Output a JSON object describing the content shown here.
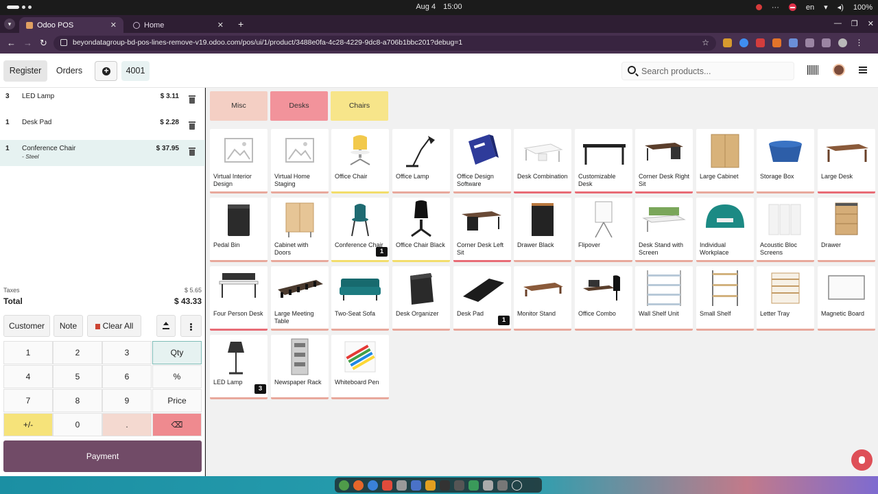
{
  "os": {
    "date": "Aug 4",
    "time": "15:00",
    "lang": "en",
    "battery": "100%"
  },
  "browser": {
    "tabs": [
      {
        "title": "Odoo POS",
        "active": true
      },
      {
        "title": "Home",
        "active": false
      }
    ],
    "url": "beyondatagroup-bd-pos-lines-remove-v19.odoo.com/pos/ui/1/product/3488e0fa-4c28-4229-9dc8-a706b1bbc201?debug=1"
  },
  "nav": {
    "register": "Register",
    "orders": "Orders",
    "order_number": "4001",
    "search_placeholder": "Search products..."
  },
  "order_lines": [
    {
      "qty": "3",
      "name": "LED Lamp",
      "price": "$ 3.11",
      "note": ""
    },
    {
      "qty": "1",
      "name": "Desk Pad",
      "price": "$ 2.28",
      "note": ""
    },
    {
      "qty": "1",
      "name": "Conference Chair",
      "price": "$ 37.95",
      "note": "- Steel",
      "selected": true
    }
  ],
  "totals": {
    "taxes_label": "Taxes",
    "taxes": "$ 5.65",
    "total_label": "Total",
    "total": "$ 43.33"
  },
  "actions": {
    "customer": "Customer",
    "note": "Note",
    "clear_all": "Clear All"
  },
  "numpad": [
    "1",
    "2",
    "3",
    "Qty",
    "4",
    "5",
    "6",
    "%",
    "7",
    "8",
    "9",
    "Price",
    "+/-",
    "0",
    ".",
    "⌫"
  ],
  "payment": "Payment",
  "categories": [
    {
      "name": "Misc",
      "color": "#f4cfc4"
    },
    {
      "name": "Desks",
      "color": "#f2939b"
    },
    {
      "name": "Chairs",
      "color": "#f7e58a"
    }
  ],
  "products": [
    {
      "name": "Virtual Interior Design",
      "strip": "#e8a89c",
      "icon": "image-placeholder"
    },
    {
      "name": "Virtual Home Staging",
      "strip": "#e8a89c",
      "icon": "image-placeholder"
    },
    {
      "name": "Office Chair",
      "strip": "#f2dd6b",
      "icon": "chair-yellow"
    },
    {
      "name": "Office Lamp",
      "strip": "#e8a89c",
      "icon": "desk-lamp"
    },
    {
      "name": "Office Design Software",
      "strip": "#e8a89c",
      "icon": "software-box"
    },
    {
      "name": "Desk Combination",
      "strip": "#e86c76",
      "icon": "desk-white"
    },
    {
      "name": "Customizable Desk",
      "strip": "#e86c76",
      "icon": "desk-black"
    },
    {
      "name": "Corner Desk Right Sit",
      "strip": "#e86c76",
      "icon": "desk-corner"
    },
    {
      "name": "Large Cabinet",
      "strip": "#e8a89c",
      "icon": "cabinet-wood"
    },
    {
      "name": "Storage Box",
      "strip": "#e8a89c",
      "icon": "storage-box"
    },
    {
      "name": "Large Desk",
      "strip": "#e86c76",
      "icon": "desk-wood"
    },
    {
      "name": "Pedal Bin",
      "strip": "#e8a89c",
      "icon": "pedal-bin"
    },
    {
      "name": "Cabinet with Doors",
      "strip": "#e8a89c",
      "icon": "cabinet-doors"
    },
    {
      "name": "Conference Chair",
      "strip": "#f2dd6b",
      "icon": "chair-teal",
      "qty": "1"
    },
    {
      "name": "Office Chair Black",
      "strip": "#f2dd6b",
      "icon": "chair-black"
    },
    {
      "name": "Corner Desk Left Sit",
      "strip": "#e86c76",
      "icon": "desk-corner-left"
    },
    {
      "name": "Drawer Black",
      "strip": "#e8a89c",
      "icon": "drawer-black"
    },
    {
      "name": "Flipover",
      "strip": "#e8a89c",
      "icon": "flipchart"
    },
    {
      "name": "Desk Stand with Screen",
      "strip": "#e8a89c",
      "icon": "desk-screen"
    },
    {
      "name": "Individual Workplace",
      "strip": "#e8a89c",
      "icon": "workplace"
    },
    {
      "name": "Acoustic Bloc Screens",
      "strip": "#e8a89c",
      "icon": "screens"
    },
    {
      "name": "Drawer",
      "strip": "#e8a89c",
      "icon": "drawer-wood"
    },
    {
      "name": "Four Person Desk",
      "strip": "#e86c76",
      "icon": "desk-four"
    },
    {
      "name": "Large Meeting Table",
      "strip": "#e8a89c",
      "icon": "meeting-table"
    },
    {
      "name": "Two-Seat Sofa",
      "strip": "#e8a89c",
      "icon": "sofa"
    },
    {
      "name": "Desk Organizer",
      "strip": "#e8a89c",
      "icon": "organizer"
    },
    {
      "name": "Desk Pad",
      "strip": "#e8a89c",
      "icon": "desk-pad",
      "qty": "1"
    },
    {
      "name": "Monitor Stand",
      "strip": "#e8a89c",
      "icon": "monitor-stand"
    },
    {
      "name": "Office Combo",
      "strip": "#e8a89c",
      "icon": "office-combo"
    },
    {
      "name": "Wall Shelf Unit",
      "strip": "#e8a89c",
      "icon": "wall-shelf"
    },
    {
      "name": "Small Shelf",
      "strip": "#e8a89c",
      "icon": "small-shelf"
    },
    {
      "name": "Letter Tray",
      "strip": "#e8a89c",
      "icon": "letter-tray"
    },
    {
      "name": "Magnetic Board",
      "strip": "#e8a89c",
      "icon": "whiteboard"
    },
    {
      "name": "LED Lamp",
      "strip": "#e8a89c",
      "icon": "led-lamp",
      "qty": "3"
    },
    {
      "name": "Newspaper Rack",
      "strip": "#e8a89c",
      "icon": "newspaper-rack"
    },
    {
      "name": "Whiteboard Pen",
      "strip": "#e8a89c",
      "icon": "markers"
    }
  ]
}
